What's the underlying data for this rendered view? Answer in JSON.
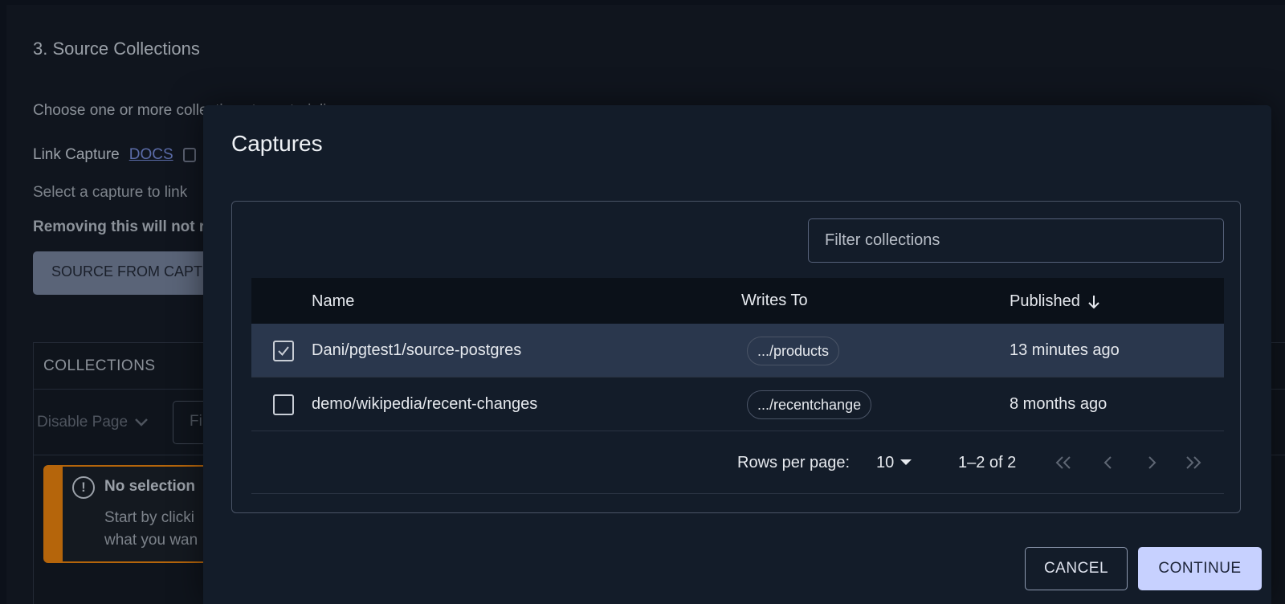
{
  "background": {
    "section_title": "3. Source Collections",
    "description": "Choose one or more collections to materialize.",
    "link_label": "Link Capture",
    "docs_link": "DOCS",
    "select_text": "Select a capture to link",
    "removing_text": "Removing this will not r",
    "source_button": "SOURCE FROM CAPTURE",
    "collections_header": "COLLECTIONS",
    "disable_page": "Disable Page",
    "filter_partial": "Fil",
    "alert": {
      "title": "No selection",
      "line1": "Start by clicki",
      "line2": "what you wan"
    }
  },
  "modal": {
    "title": "Captures",
    "filter_placeholder": "Filter collections",
    "columns": {
      "name": "Name",
      "writes_to": "Writes To",
      "published": "Published"
    },
    "rows": [
      {
        "name": "Dani/pgtest1/source-postgres",
        "writes_to": ".../products",
        "published": "13 minutes ago",
        "checked": true
      },
      {
        "name": "demo/wikipedia/recent-changes",
        "writes_to": ".../recentchange",
        "published": "8 months ago",
        "checked": false
      }
    ],
    "pagination": {
      "rows_per_page_label": "Rows per page:",
      "rows_per_page": "10",
      "range": "1–2 of 2"
    },
    "cancel_label": "CANCEL",
    "continue_label": "CONTINUE"
  },
  "colors": {
    "modal_bg": "#131c29",
    "selected_row": "#2a374d",
    "accent_button": "#c7d1ff",
    "alert_border": "#b5650b"
  }
}
